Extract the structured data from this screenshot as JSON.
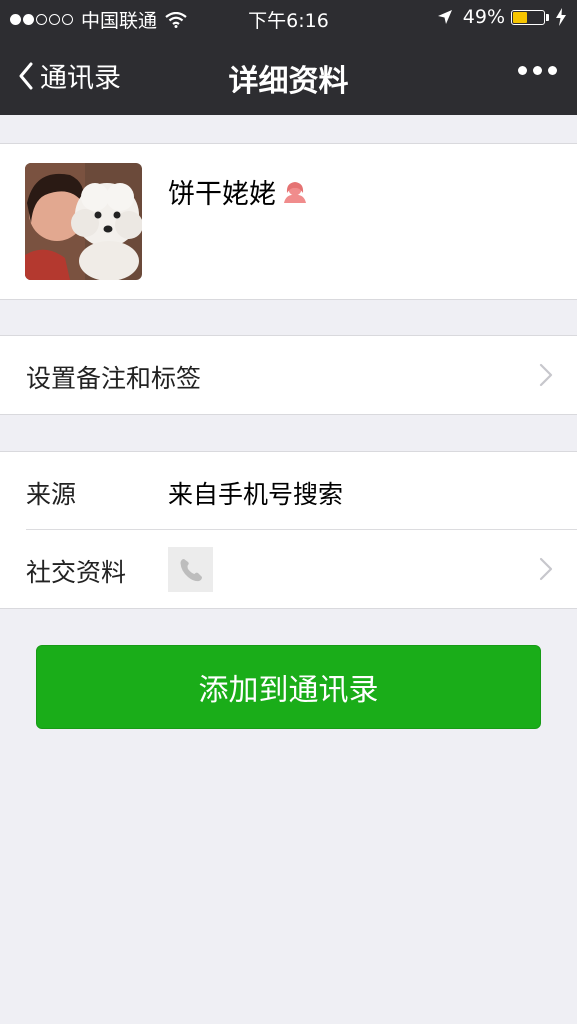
{
  "status_bar": {
    "carrier": "中国联通",
    "time": "下午6:16",
    "battery": "49%",
    "battery_level": 0.49,
    "signal_bars_filled": 2,
    "signal_bars_total": 5
  },
  "nav": {
    "back_label": "通讯录",
    "title": "详细资料"
  },
  "profile": {
    "name": "饼干姥姥",
    "gender_icon": "female-icon"
  },
  "remark_row": {
    "label": "设置备注和标签"
  },
  "info_rows": {
    "source_label": "来源",
    "source_value": "来自手机号搜索",
    "social_label": "社交资料"
  },
  "action": {
    "add_button": "添加到通讯录"
  },
  "colors": {
    "accent_green": "#1aad19",
    "navbar": "#2d2d31",
    "background": "#efeff4"
  }
}
